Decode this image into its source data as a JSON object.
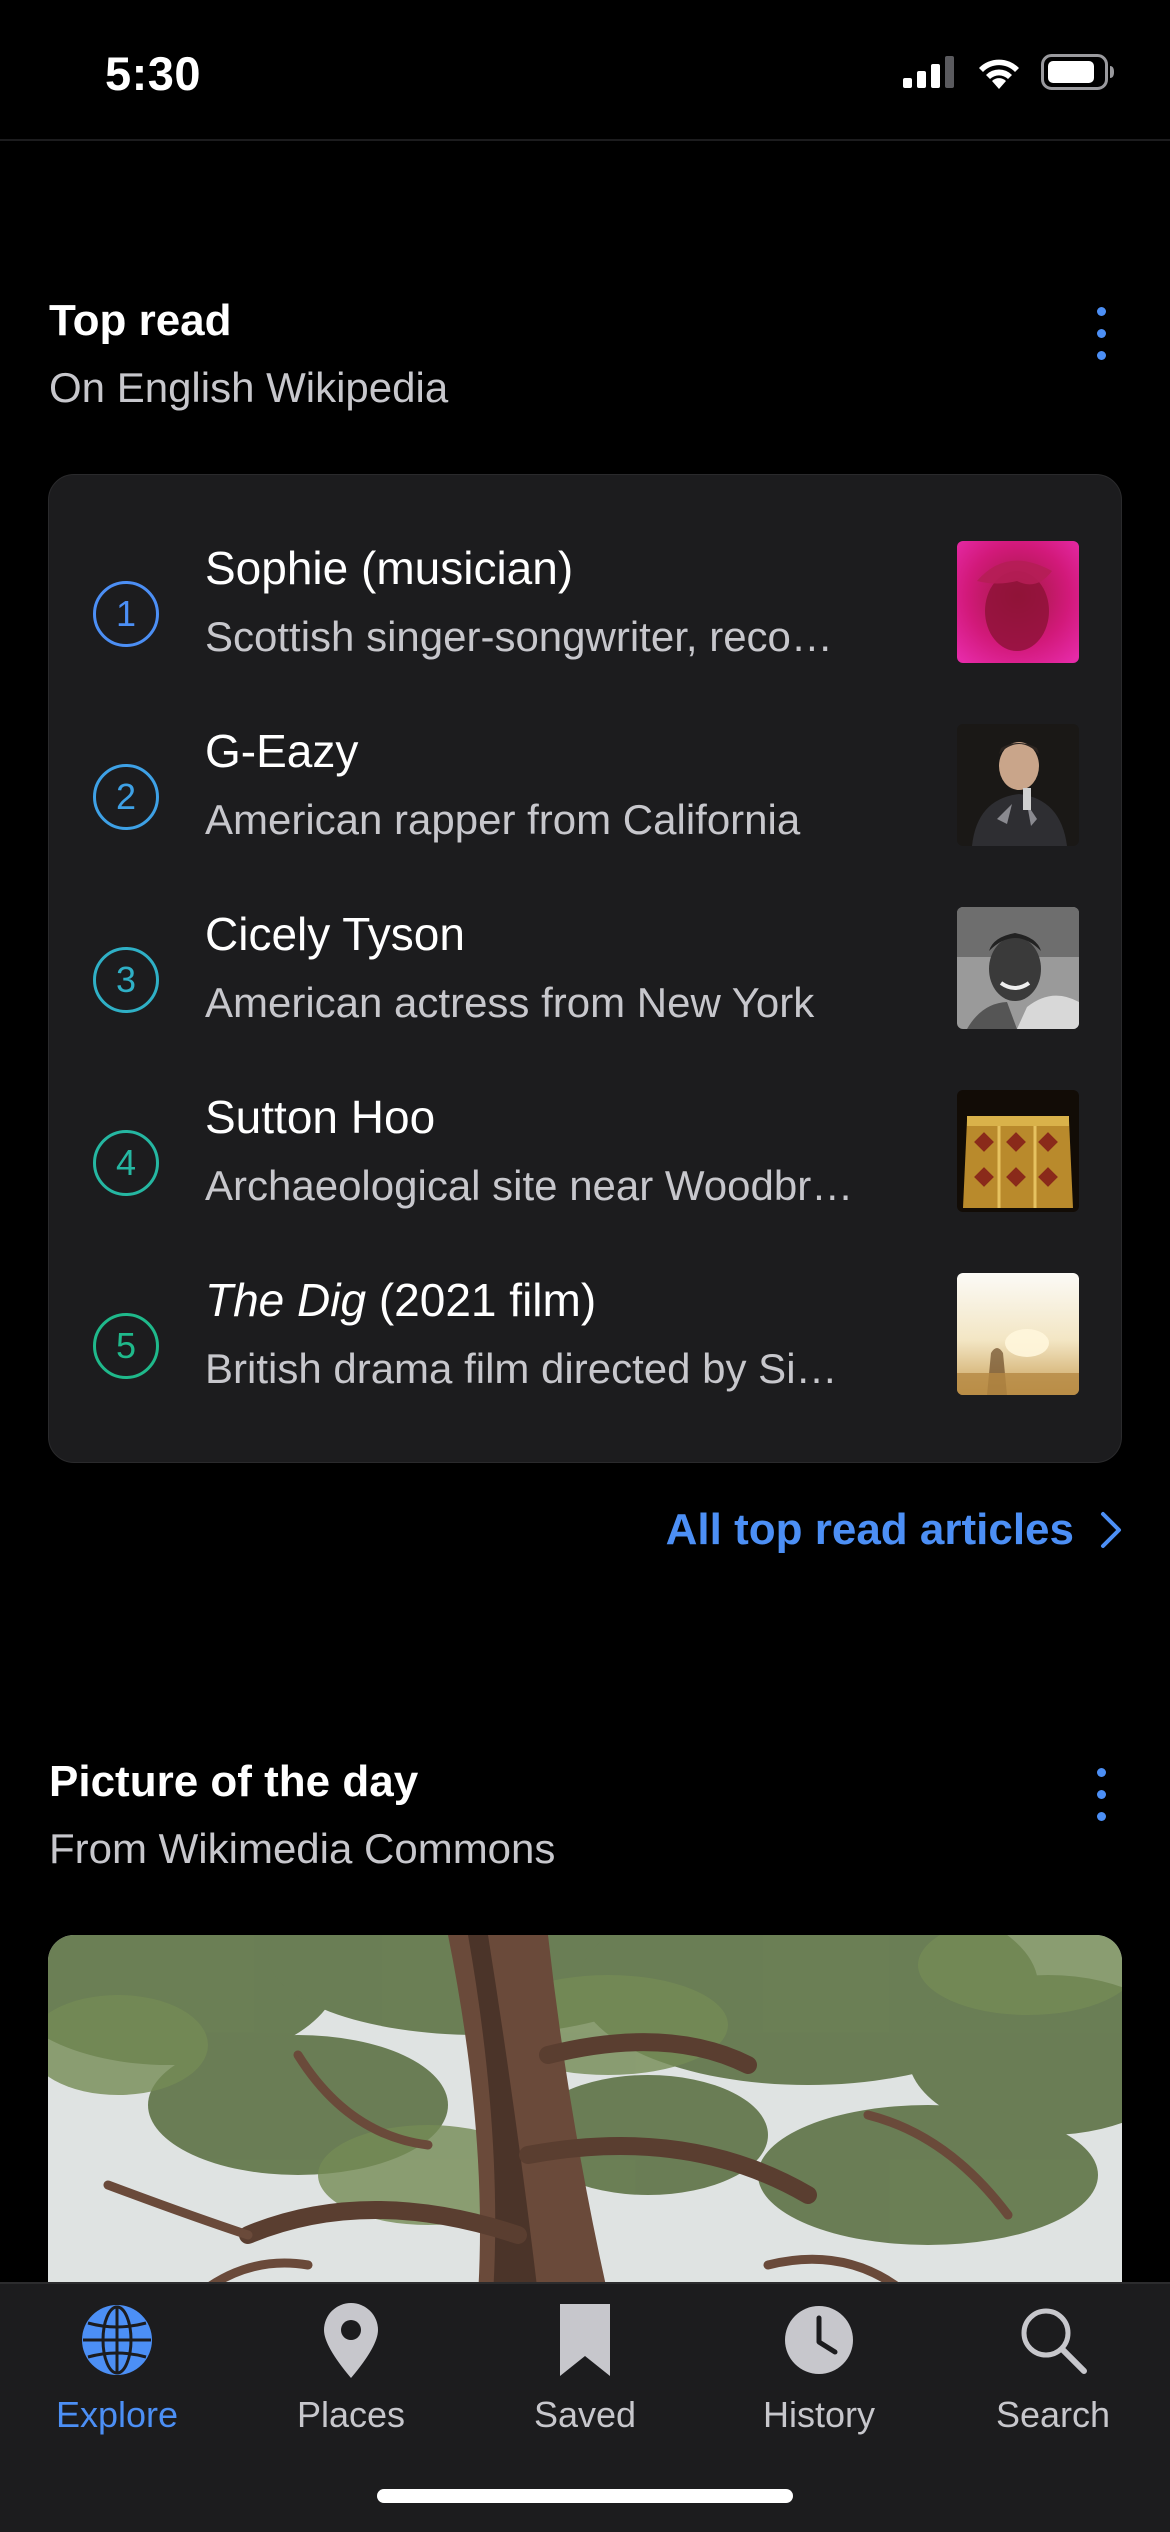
{
  "status_bar": {
    "time": "5:30"
  },
  "top_read": {
    "title": "Top read",
    "subtitle": "On English Wikipedia",
    "articles": [
      {
        "rank": "1",
        "title": "Sophie (musician)",
        "description": "Scottish singer-songwriter, reco…",
        "rank_color": "#4c8ff5"
      },
      {
        "rank": "2",
        "title": "G-Eazy",
        "description": "American rapper from California",
        "rank_color": "#3ea1e6"
      },
      {
        "rank": "3",
        "title": "Cicely Tyson",
        "description": "American actress from New York",
        "rank_color": "#2fb0c6"
      },
      {
        "rank": "4",
        "title": "Sutton Hoo",
        "description": "Archaeological site near Woodbr…",
        "rank_color": "#25b7a2"
      },
      {
        "rank": "5",
        "title_italic": "The Dig",
        "title_rest": " (2021 film)",
        "description": "British drama film directed by Si…",
        "rank_color": "#1fb98b"
      }
    ],
    "all_link": "All top read articles"
  },
  "picture_of_day": {
    "title": "Picture of the day",
    "subtitle": "From Wikimedia Commons"
  },
  "tab_bar": {
    "tabs": [
      {
        "label": "Explore",
        "icon": "globe-icon",
        "active": true
      },
      {
        "label": "Places",
        "icon": "map-pin-icon"
      },
      {
        "label": "Saved",
        "icon": "bookmark-icon"
      },
      {
        "label": "History",
        "icon": "clock-icon"
      },
      {
        "label": "Search",
        "icon": "search-icon"
      }
    ]
  },
  "colors": {
    "accent": "#4c8ff5",
    "card": "#1c1c1e",
    "background": "#000000"
  }
}
